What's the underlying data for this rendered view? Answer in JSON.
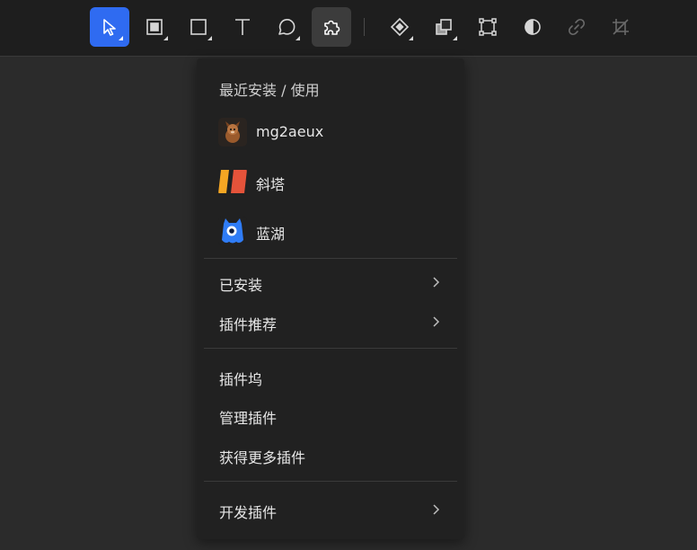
{
  "toolbar": {
    "tools": [
      {
        "name": "move-tool",
        "icon": "pointer-arrow-icon"
      },
      {
        "name": "frame-tool",
        "icon": "frame-icon"
      },
      {
        "name": "rectangle-tool",
        "icon": "rectangle-icon"
      },
      {
        "name": "text-tool",
        "icon": "text-t-icon"
      },
      {
        "name": "comment-tool",
        "icon": "speech-bubble-icon"
      },
      {
        "name": "plugins-tool",
        "icon": "puzzle-piece-icon"
      },
      {
        "name": "component-tool",
        "icon": "diamond-component-icon"
      },
      {
        "name": "boolean-tool",
        "icon": "boolean-union-icon"
      },
      {
        "name": "transform-tool",
        "icon": "bounding-box-icon"
      },
      {
        "name": "mask-tool",
        "icon": "half-circle-icon"
      },
      {
        "name": "link-tool",
        "icon": "link-icon"
      },
      {
        "name": "crop-tool",
        "icon": "crop-icon"
      }
    ],
    "accent": "#2f6bf1"
  },
  "menu": {
    "recent_title": "最近安装 / 使用",
    "recent_plugins": [
      {
        "label": "mg2aeux",
        "icon": "dog-avatar-icon"
      },
      {
        "label": "斜塔",
        "icon": "xieta-logo-icon"
      },
      {
        "label": "蓝湖",
        "icon": "lanhu-monster-icon"
      }
    ],
    "installed_label": "已安装",
    "recommend_label": "插件推荐",
    "dock_label": "插件坞",
    "manage_label": "管理插件",
    "more_label": "获得更多插件",
    "develop_label": "开发插件"
  }
}
